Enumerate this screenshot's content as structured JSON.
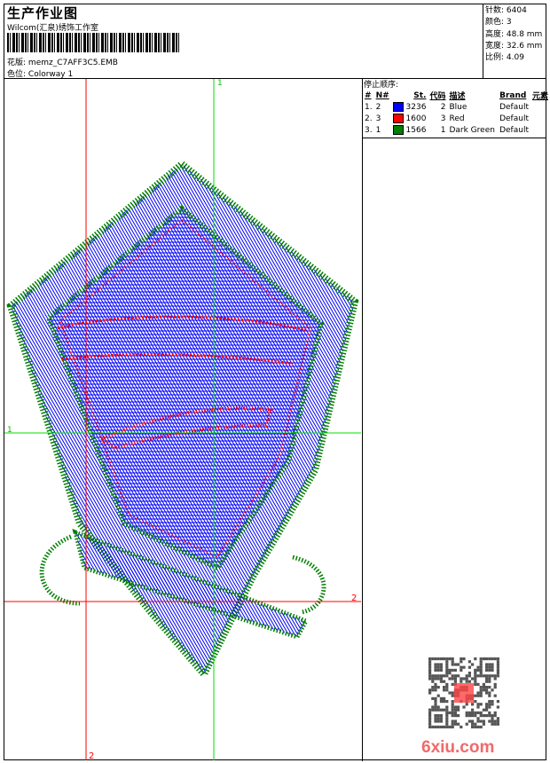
{
  "header": {
    "title": "生产作业图",
    "company": "Wilcom(汇泉)绣饰工作室",
    "design_label": "花版:",
    "design_file": "memz_C7AFF3C5.EMB",
    "colorway_label": "色位:",
    "colorway": "Colorway 1"
  },
  "info": {
    "stitches": "针数: 6404",
    "colors": "颜色: 3",
    "height": "高度: 48.8 mm",
    "width": "宽度: 32.6 mm",
    "scale": "比例: 4.09"
  },
  "stop_sequence": {
    "title": "停止顺序:",
    "columns": [
      "#",
      "N#",
      "St.",
      "代码",
      "描述",
      "Brand",
      "元素"
    ],
    "rows": [
      {
        "idx": "1.",
        "n": "2",
        "color": "#0000ff",
        "st": "3236",
        "code": "2",
        "desc": "Blue",
        "brand": "Default"
      },
      {
        "idx": "2.",
        "n": "3",
        "color": "#ff0000",
        "st": "1600",
        "code": "3",
        "desc": "Red",
        "brand": "Default"
      },
      {
        "idx": "3.",
        "n": "1",
        "color": "#008000",
        "st": "1566",
        "code": "1",
        "desc": "Dark Green",
        "brand": "Default"
      }
    ]
  },
  "crosshairs": {
    "green_label_top": "1",
    "green_label_left": "1",
    "red_label_right": "2",
    "red_label_bottom": "2"
  },
  "watermark": {
    "text": "6xiu.com",
    "seal": "以图制版"
  }
}
